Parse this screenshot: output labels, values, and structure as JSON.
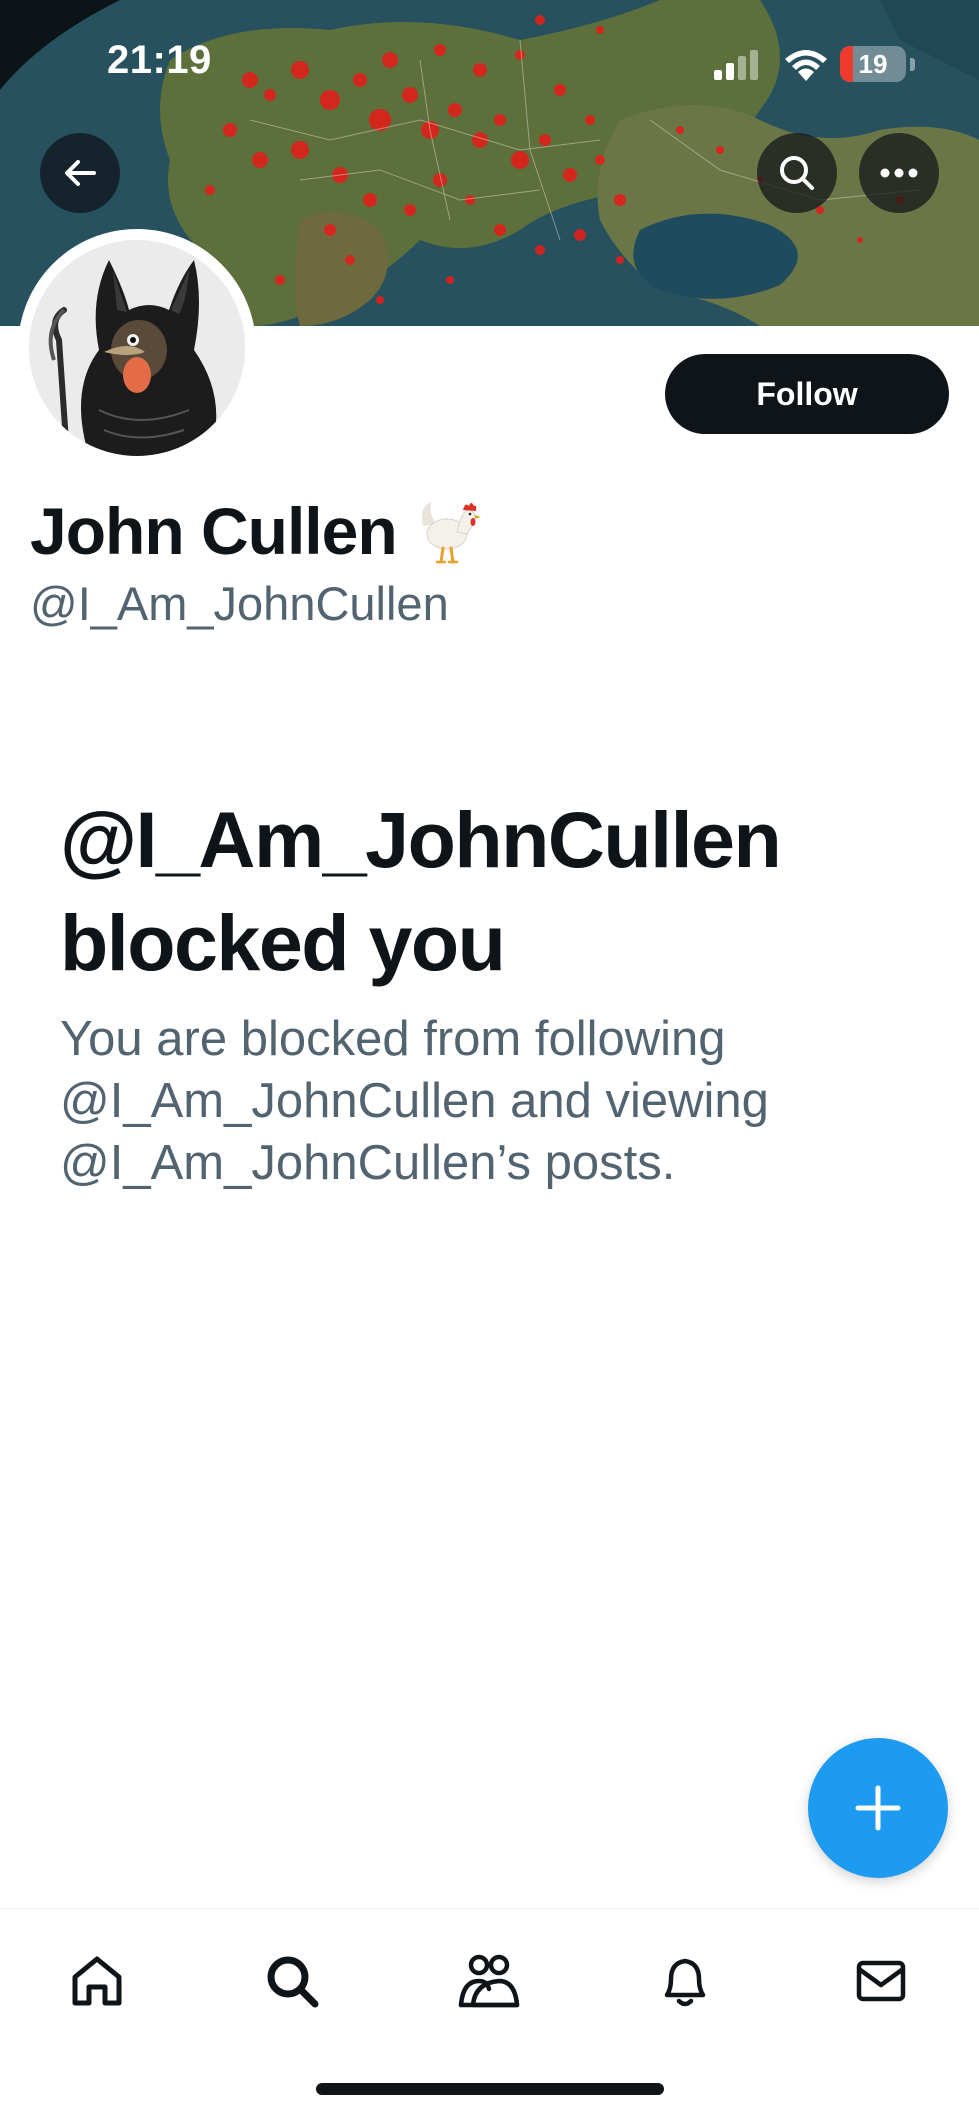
{
  "status_bar": {
    "time": "21:19",
    "battery_level": "19",
    "battery_fraction": 0.19,
    "battery_color": "#ef3b2e",
    "icons": [
      "signal-icon",
      "wifi-icon",
      "battery-icon"
    ]
  },
  "header": {
    "back_icon": "arrow-left-icon",
    "search_icon": "search-icon",
    "more_icon": "more-horizontal-icon"
  },
  "profile": {
    "display_name": "John Cullen",
    "name_emoji": "rooster-icon",
    "handle": "@I_Am_JohnCullen",
    "follow_label": "Follow"
  },
  "blocked": {
    "title": "@I_Am_JohnCullen blocked you",
    "description": "You are blocked from following @I_Am_JohnCullen and viewing @I_Am_JohnCullen’s posts."
  },
  "fab": {
    "icon": "plus-icon",
    "color": "#1d9bf0"
  },
  "bottom_nav": {
    "items": [
      "home-icon",
      "search-icon",
      "communities-icon",
      "notifications-icon",
      "messages-icon"
    ]
  },
  "colors": {
    "text_primary": "#0f1419",
    "text_secondary": "#536471",
    "accent": "#1d9bf0"
  }
}
